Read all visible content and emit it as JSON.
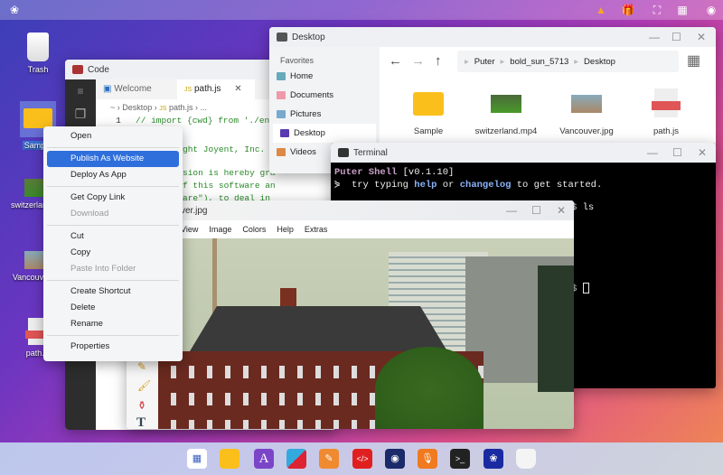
{
  "topbar": {
    "icons": [
      "puter-logo-icon",
      "warning-icon",
      "gift-icon",
      "fullscreen-icon",
      "qr-code-icon",
      "user-icon"
    ],
    "warning_color": "#f5a623"
  },
  "desktop": {
    "items": [
      {
        "label": "Trash",
        "icon": "trash-icon"
      },
      {
        "label": "Sample",
        "icon": "folder-icon",
        "selected": true
      },
      {
        "label": "switzerland.mp4",
        "icon": "video-thumbnail"
      },
      {
        "label": "Vancouver.jpg",
        "icon": "image-thumbnail"
      },
      {
        "label": "path.js",
        "icon": "js-file-icon"
      }
    ]
  },
  "explorer": {
    "title": "Desktop",
    "favorites_label": "Favorites",
    "sidebar": [
      {
        "label": "Home"
      },
      {
        "label": "Documents"
      },
      {
        "label": "Pictures"
      },
      {
        "label": "Desktop",
        "active": true
      },
      {
        "label": "Videos"
      }
    ],
    "path": [
      "Puter",
      "bold_sun_5713",
      "Desktop"
    ],
    "files": [
      {
        "name": "Sample"
      },
      {
        "name": "switzerland.mp4"
      },
      {
        "name": "Vancouver.jpg"
      },
      {
        "name": "path.js"
      }
    ]
  },
  "code": {
    "title": "Code",
    "tabs": [
      {
        "label": "Welcome"
      },
      {
        "label": "path.js",
        "active": true
      }
    ],
    "breadcrumb": [
      "~",
      "Desktop",
      "path.js",
      "..."
    ],
    "lines": [
      {
        "num": "1",
        "text": "// import {cwd} from './env"
      },
      {
        "num": "",
        "text": "ght Joyent, Inc. a"
      },
      {
        "num": "",
        "text": "sion is hereby gra"
      },
      {
        "num": "",
        "text": "f this software an"
      },
      {
        "num": "",
        "text": "are\"), to deal in"
      }
    ]
  },
  "context_menu": {
    "items": [
      {
        "label": "Open"
      },
      {
        "sep": true
      },
      {
        "label": "Publish As Website",
        "selected": true
      },
      {
        "label": "Deploy As App"
      },
      {
        "sep": true
      },
      {
        "label": "Get Copy Link"
      },
      {
        "label": "Download",
        "disabled": true
      },
      {
        "sep": true
      },
      {
        "label": "Cut"
      },
      {
        "label": "Copy"
      },
      {
        "label": "Paste Into Folder",
        "disabled": true
      },
      {
        "sep": true
      },
      {
        "label": "Create Shortcut"
      },
      {
        "label": "Delete"
      },
      {
        "label": "Rename"
      },
      {
        "sep": true
      },
      {
        "label": "Properties"
      }
    ]
  },
  "terminal": {
    "title": "Terminal",
    "shell_name": "Puter Shell",
    "version": "[v0.1.10]",
    "hint_pre": "try typing",
    "help": "help",
    "or": "or",
    "changelog": "changelog",
    "hint_post": "to get started.",
    "prompt_partial": "$ ls",
    "prompt_cursor": "$"
  },
  "image_viewer": {
    "title": "ver.jpg",
    "menu": [
      "View",
      "Image",
      "Colors",
      "Help",
      "Extras"
    ]
  },
  "taskbar": {
    "apps": [
      "app-launcher-icon",
      "files-icon",
      "editor-a-icon",
      "blocks-icon",
      "paint-icon",
      "code-icon",
      "camera-icon",
      "recorder-icon",
      "terminal-icon",
      "puter-icon",
      "trash-icon"
    ]
  }
}
